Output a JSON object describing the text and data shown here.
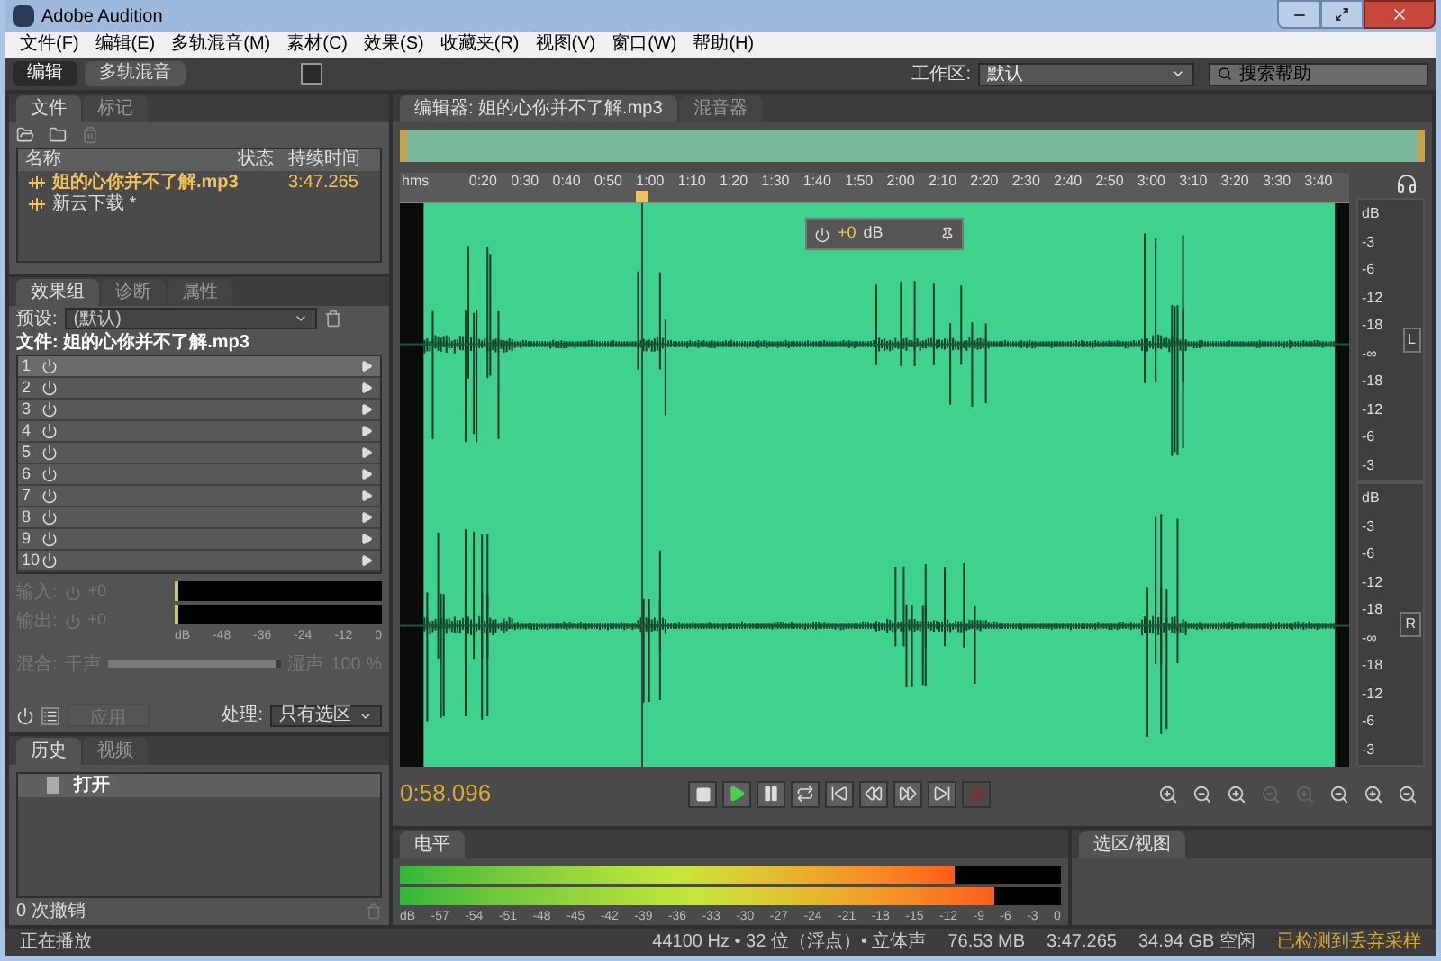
{
  "window": {
    "title": "Adobe Audition"
  },
  "menu": [
    "文件(F)",
    "编辑(E)",
    "多轨混音(M)",
    "素材(C)",
    "效果(S)",
    "收藏夹(R)",
    "视图(V)",
    "窗口(W)",
    "帮助(H)"
  ],
  "toolbar": {
    "modes": [
      {
        "label": "编辑",
        "selected": true
      },
      {
        "label": "多轨混音",
        "selected": false
      }
    ],
    "workspace_label": "工作区:",
    "workspace_value": "默认",
    "search_placeholder": "搜索帮助"
  },
  "files_panel": {
    "tabs": [
      {
        "label": "文件",
        "selected": true
      },
      {
        "label": "标记",
        "selected": false
      }
    ],
    "columns": [
      "名称",
      "状态",
      "持续时间"
    ],
    "rows": [
      {
        "name": "姐的心你并不了解.mp3",
        "duration": "3:47.265",
        "selected": true
      },
      {
        "name": "新云下载 *",
        "selected": false
      }
    ]
  },
  "effects_panel": {
    "tabs": [
      {
        "label": "效果组",
        "selected": true
      },
      {
        "label": "诊断",
        "selected": false
      },
      {
        "label": "属性",
        "selected": false
      }
    ],
    "preset_label": "预设:",
    "preset_value": "(默认)",
    "file_line": "文件: 姐的心你并不了解.mp3",
    "slots": [
      {
        "number": "1",
        "selected": true
      },
      {
        "number": "2",
        "selected": false
      },
      {
        "number": "3",
        "selected": false
      },
      {
        "number": "4",
        "selected": false
      },
      {
        "number": "5",
        "selected": false
      },
      {
        "number": "6",
        "selected": false
      },
      {
        "number": "7",
        "selected": false
      },
      {
        "number": "8",
        "selected": false
      },
      {
        "number": "9",
        "selected": false
      },
      {
        "number": "10",
        "selected": false
      }
    ],
    "gains": [
      {
        "label": "输入:",
        "value": "+0"
      },
      {
        "label": "输出:",
        "value": "+0"
      }
    ],
    "meter_scale": [
      "dB",
      "-48",
      "-36",
      "-24",
      "-12",
      "0"
    ],
    "mix": {
      "label": "混合:",
      "dry": "干声",
      "wet": "湿声",
      "percent": "100 %",
      "level": 0.97
    },
    "apply_button": {
      "label": "应用",
      "disabled": true
    },
    "process_label": "处理:",
    "process_value": "只有选区"
  },
  "history_panel": {
    "tabs": [
      {
        "label": "历史",
        "selected": true
      },
      {
        "label": "视频",
        "selected": false
      }
    ],
    "items": [
      {
        "label": "打开",
        "selected": true
      }
    ],
    "undo_count": "0 次撤销"
  },
  "editor": {
    "tabs": [
      {
        "label": "编辑器: 姐的心你并不了解.mp3",
        "selected": true
      },
      {
        "label": "混音器",
        "selected": false
      }
    ],
    "ruler_labels": [
      "hms",
      "0:20",
      "0:30",
      "0:40",
      "0:50",
      "1:00",
      "1:10",
      "1:20",
      "1:30",
      "1:40",
      "1:50",
      "2:00",
      "2:10",
      "2:20",
      "2:30",
      "2:40",
      "2:50",
      "3:00",
      "3:10",
      "3:20",
      "3:30",
      "3:40"
    ],
    "hud": {
      "gain": "+0",
      "unit": "dB"
    },
    "channels": [
      {
        "label": "L",
        "db_scale": [
          "dB",
          "-3",
          "-6",
          "-12",
          "-18",
          "-∞",
          "-18",
          "-12",
          "-6",
          "-3"
        ]
      },
      {
        "label": "R",
        "db_scale": [
          "dB",
          "-3",
          "-6",
          "-12",
          "-18",
          "-∞",
          "-18",
          "-12",
          "-6",
          "-3"
        ]
      }
    ],
    "playhead": {
      "level": 0.255
    },
    "time": "0:58.096",
    "transport": [
      {
        "kind": "stop",
        "disabled": false
      },
      {
        "kind": "play",
        "disabled": false
      },
      {
        "kind": "pause",
        "disabled": false
      },
      {
        "kind": "loop",
        "disabled": false
      },
      {
        "kind": "start",
        "disabled": false
      },
      {
        "kind": "rewind",
        "disabled": false
      },
      {
        "kind": "forward",
        "disabled": false
      },
      {
        "kind": "end",
        "disabled": false
      },
      {
        "kind": "record",
        "disabled": true
      }
    ],
    "zoom": [
      {
        "kind": "in",
        "disabled": false
      },
      {
        "kind": "out",
        "disabled": false
      },
      {
        "kind": "in",
        "disabled": false
      },
      {
        "kind": "out",
        "disabled": true
      },
      {
        "kind": "in",
        "disabled": true
      },
      {
        "kind": "out",
        "disabled": false
      },
      {
        "kind": "in",
        "disabled": false
      },
      {
        "kind": "out",
        "disabled": false
      }
    ]
  },
  "levels_panel": {
    "tab": "电平",
    "meters": [
      {
        "level": 0.84
      },
      {
        "level": 0.9
      }
    ],
    "scale": [
      "dB",
      "-57",
      "-54",
      "-51",
      "-48",
      "-45",
      "-42",
      "-39",
      "-36",
      "-33",
      "-30",
      "-27",
      "-24",
      "-21",
      "-18",
      "-15",
      "-12",
      "-9",
      "-6",
      "-3",
      "0"
    ]
  },
  "selection_panel": {
    "tab": "选区/视图"
  },
  "status_bar": {
    "state": "正在播放",
    "format": "44100 Hz • 32 位（浮点）• 立体声",
    "size": "76.53 MB",
    "duration": "3:47.265",
    "free": "34.94 GB 空闲",
    "warning": "已检测到丢弃采样"
  }
}
